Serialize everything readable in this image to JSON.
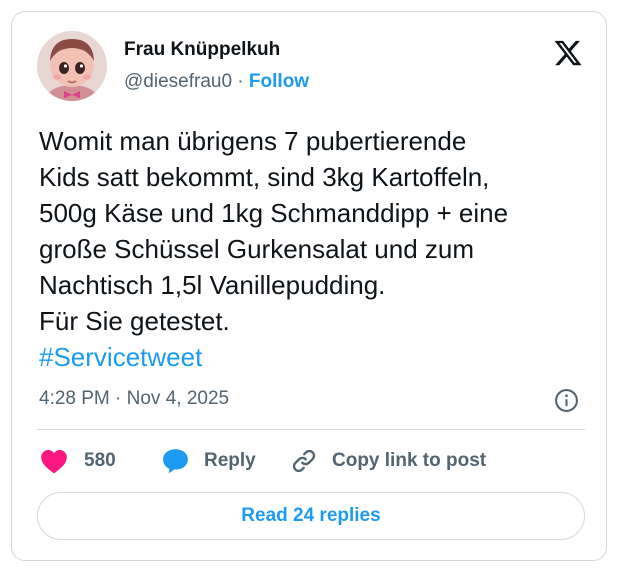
{
  "author": {
    "name": "Frau Knüppelkuh",
    "handle": "@diesefrau0",
    "separator": " · ",
    "follow_label": "Follow"
  },
  "tweet": {
    "lines": [
      "Womit man übrigens 7 pubertierende",
      "Kids satt bekommt, sind 3kg Kartoffeln,",
      "500g Käse und 1kg Schmanddipp + eine",
      "große Schüssel Gurkensalat und zum",
      "Nachtisch 1,5l Vanillepudding.",
      "Für Sie getestet."
    ],
    "hashtag": "#Servicetweet",
    "timestamp": "4:28 PM · Nov 4, 2025"
  },
  "actions": {
    "like_count": "580",
    "reply_label": "Reply",
    "copy_label": "Copy link to post"
  },
  "footer": {
    "read_replies_label": "Read 24 replies"
  },
  "icons": {
    "brand": "x-logo-icon",
    "info": "info-icon",
    "like": "heart-icon",
    "reply": "speech-bubble-icon",
    "copy": "link-icon"
  },
  "colors": {
    "accent": "#1d9bf0",
    "like": "#f91880",
    "text": "#0f1419",
    "secondary": "#536471",
    "border": "#cfd9de"
  }
}
